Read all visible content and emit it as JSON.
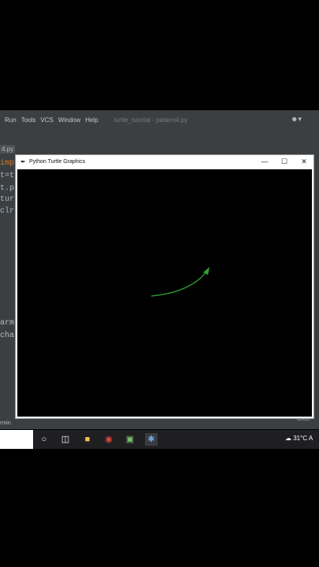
{
  "ide": {
    "menu": [
      "Run",
      "Tools",
      "VCS",
      "Window",
      "Help"
    ],
    "project_title": "turtle_tutorial - pattern4.py",
    "file_tab": "4.py",
    "code_lines": [
      "imp",
      "t=t",
      "t.p",
      "tur",
      "clr"
    ],
    "terminal_lines": [
      "arm",
      "char"
    ],
    "status_left": "rmin",
    "status_right": "CRLF"
  },
  "turtle_window": {
    "title": "Python Turtle Graphics",
    "minimize": "—",
    "maximize": "☐",
    "close": "✕",
    "stroke_color": "#2fa52f"
  },
  "taskbar": {
    "weather": "31°C",
    "weather_suffix": "A"
  }
}
